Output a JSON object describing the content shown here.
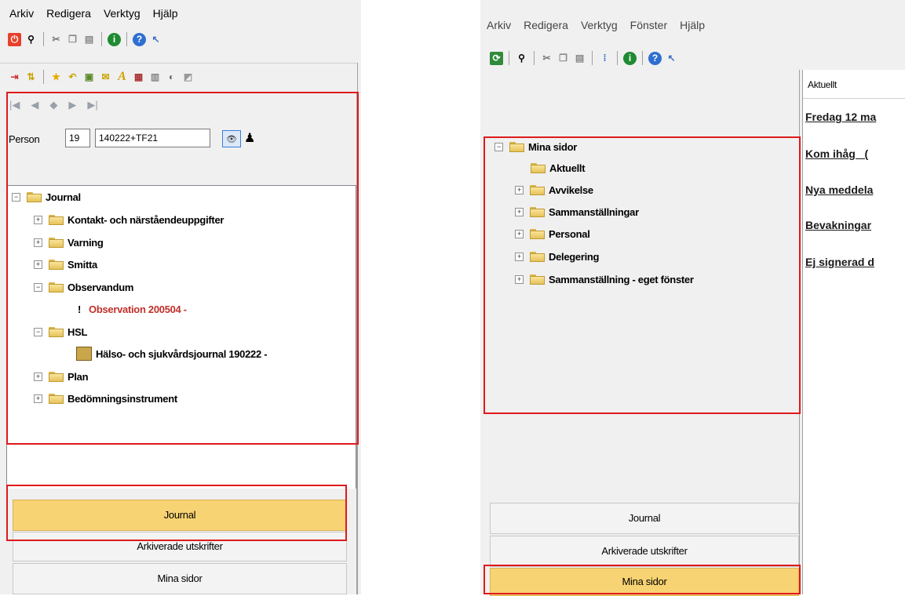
{
  "left": {
    "menu": [
      "Arkiv",
      "Redigera",
      "Verktyg",
      "Hjälp"
    ],
    "person": {
      "label": "Person",
      "century": "19",
      "number": "140222+TF21"
    },
    "tree": {
      "root": "Journal",
      "items": [
        "Kontakt- och närståendeuppgifter",
        "Varning",
        "Smitta",
        "Observandum",
        "Observation 200504 -",
        "HSL",
        "Hälso- och sjukvårdsjournal 190222 -",
        "Plan",
        "Bedömningsinstrument"
      ],
      "observation_marker": "!"
    },
    "nav": [
      "Journal",
      "Arkiverade utskrifter",
      "Mina sidor"
    ]
  },
  "right": {
    "menu": [
      "Arkiv",
      "Redigera",
      "Verktyg",
      "Fönster",
      "Hjälp"
    ],
    "tree": {
      "root": "Mina sidor",
      "items": [
        "Aktuellt",
        "Avvikelse",
        "Sammanställningar",
        "Personal",
        "Delegering",
        "Sammanställning - eget fönster"
      ]
    },
    "content": {
      "header": "Aktuellt",
      "links": [
        "Fredag 12 ma",
        "Kom ihåg   (",
        "Nya meddela",
        "Bevakningar",
        "Ej signerad d"
      ]
    },
    "nav": [
      "Journal",
      "Arkiverade utskrifter",
      "Mina sidor"
    ]
  }
}
